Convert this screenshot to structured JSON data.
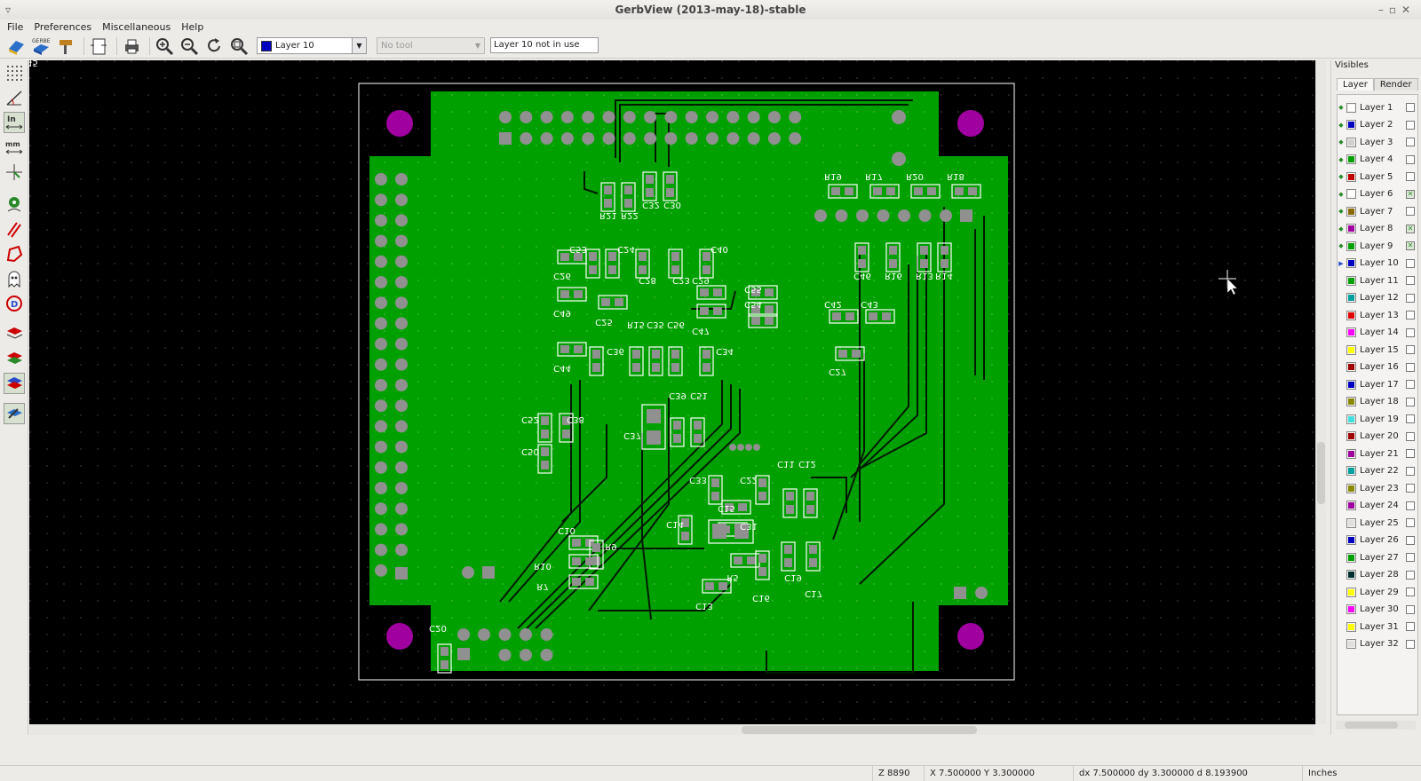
{
  "window": {
    "title": "GerbView (2013-may-18)-stable"
  },
  "menu": {
    "file": "File",
    "preferences": "Preferences",
    "miscellaneous": "Miscellaneous",
    "help": "Help"
  },
  "toolbar": {
    "active_layer": "Layer 10",
    "tool_select": "No tool",
    "layer_status": "Layer 10 not in use"
  },
  "left_toolbar": {
    "units_in_label": "In",
    "units_mm_label": "mm"
  },
  "right_panel": {
    "title": "Visibles",
    "tabs": [
      "Layer",
      "Render"
    ],
    "active_layer_index": 9,
    "layers": [
      {
        "name": "Layer 1",
        "color": "#ffffff",
        "visible": false
      },
      {
        "name": "Layer 2",
        "color": "#0000c0",
        "visible": false
      },
      {
        "name": "Layer 3",
        "color": "#d0d0d0",
        "visible": false
      },
      {
        "name": "Layer 4",
        "color": "#00a000",
        "visible": false
      },
      {
        "name": "Layer 5",
        "color": "#c00000",
        "visible": false
      },
      {
        "name": "Layer 6",
        "color": "#ffffff",
        "visible": true
      },
      {
        "name": "Layer 7",
        "color": "#8a6a00",
        "visible": false
      },
      {
        "name": "Layer 8",
        "color": "#a000a0",
        "visible": true
      },
      {
        "name": "Layer 9",
        "color": "#00a000",
        "visible": true
      },
      {
        "name": "Layer 10",
        "color": "#0000c0",
        "visible": false
      },
      {
        "name": "Layer 11",
        "color": "#00a000",
        "visible": false
      },
      {
        "name": "Layer 12",
        "color": "#00a0a0",
        "visible": false
      },
      {
        "name": "Layer 13",
        "color": "#e00000",
        "visible": false
      },
      {
        "name": "Layer 14",
        "color": "#ff00ff",
        "visible": false
      },
      {
        "name": "Layer 15",
        "color": "#ffff00",
        "visible": false
      },
      {
        "name": "Layer 16",
        "color": "#a00000",
        "visible": false
      },
      {
        "name": "Layer 17",
        "color": "#0000c0",
        "visible": false
      },
      {
        "name": "Layer 18",
        "color": "#8a8a00",
        "visible": false
      },
      {
        "name": "Layer 19",
        "color": "#40e0e0",
        "visible": false
      },
      {
        "name": "Layer 20",
        "color": "#a00000",
        "visible": false
      },
      {
        "name": "Layer 21",
        "color": "#a000a0",
        "visible": false
      },
      {
        "name": "Layer 22",
        "color": "#00a0a0",
        "visible": false
      },
      {
        "name": "Layer 23",
        "color": "#8a8a00",
        "visible": false
      },
      {
        "name": "Layer 24",
        "color": "#a000a0",
        "visible": false
      },
      {
        "name": "Layer 25",
        "color": "#e0e0e0",
        "visible": false
      },
      {
        "name": "Layer 26",
        "color": "#0000c0",
        "visible": false
      },
      {
        "name": "Layer 27",
        "color": "#00a000",
        "visible": false
      },
      {
        "name": "Layer 28",
        "color": "#003030",
        "visible": false
      },
      {
        "name": "Layer 29",
        "color": "#ffff00",
        "visible": false
      },
      {
        "name": "Layer 30",
        "color": "#ff00ff",
        "visible": false
      },
      {
        "name": "Layer 31",
        "color": "#ffff00",
        "visible": false
      },
      {
        "name": "Layer 32",
        "color": "#e0e0e0",
        "visible": false
      }
    ]
  },
  "statusbar": {
    "zoom": "Z 8890",
    "coords": "X 7.500000  Y 3.300000",
    "delta": "dx 7.500000  dy 3.300000  d 8.193900",
    "units": "Inches"
  },
  "pcb": {
    "colors": {
      "background": "#000000",
      "board": "#00a000",
      "copper_trace": "#003000",
      "pad": "#909090",
      "silk": "#ffffff",
      "mounting_hole": "#a000a0"
    },
    "silkscreen_labels": [
      "R19",
      "R17",
      "R20",
      "R18",
      "R21",
      "R22",
      "C32",
      "C30",
      "C53",
      "C24",
      "C28",
      "C40",
      "C23",
      "C26",
      "C29",
      "C55",
      "C49",
      "C25",
      "C54",
      "C47",
      "C42",
      "C43",
      "C46",
      "R16",
      "R13",
      "R14",
      "R15",
      "C35",
      "C56",
      "C36",
      "C34",
      "C44",
      "C27",
      "C39",
      "C51",
      "C52",
      "C38",
      "C37",
      "C50",
      "C33",
      "C22",
      "C11",
      "C12",
      "C15",
      "C14",
      "C31",
      "C10",
      "R9",
      "R10",
      "R7",
      "R5",
      "C19",
      "C16",
      "C17",
      "C13",
      "C20",
      "C45"
    ]
  }
}
